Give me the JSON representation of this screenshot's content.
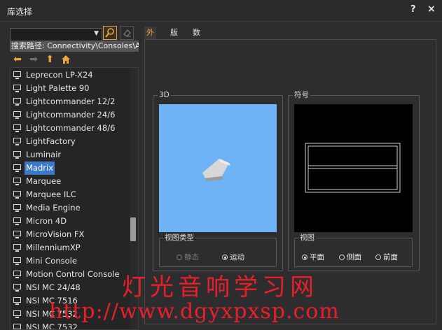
{
  "window": {
    "title": "库选择",
    "help": "?",
    "close": "×"
  },
  "search": {
    "value": "",
    "path": "搜索路径: Connectivity\\Consoles\\All"
  },
  "icons": {
    "find": "search-icon",
    "clear": "eraser-icon",
    "back": "arrow-left-icon",
    "forward": "arrow-right-icon",
    "up": "arrow-up-icon",
    "home": "home-icon",
    "item": "monitor-icon"
  },
  "colors": {
    "accent": "#f0a43a",
    "selection": "#3a78c8",
    "preview_bg": "#6fb3f7",
    "watermark": "#e8202a"
  },
  "list": {
    "selected_index": 7,
    "items": [
      "Leprecon LP-X24",
      "Light Palette 90",
      "Lightcommander 12/2",
      "Lightcommander 24/6",
      "Lightcommander 48/6",
      "LightFactory",
      "Luminair",
      "Madrix",
      "Marquee",
      "Marquee ILC",
      "Media Engine",
      "Micron 4D",
      "MicroVision FX",
      "MillenniumXP",
      "Mini Console",
      "Motion Control Console",
      "NSI MC 24/48",
      "NSI MC 7516",
      "NSI MC 7532",
      "NSI MC 7532"
    ]
  },
  "tabs": [
    "外观",
    "版本",
    "数据"
  ],
  "preview": {
    "label_3d": "3D",
    "label_symbol": "符号",
    "view_type_label": "视图类型",
    "view_type_options": [
      {
        "label": "静态",
        "checked": false,
        "disabled": true
      },
      {
        "label": "运动",
        "checked": true,
        "disabled": false
      }
    ],
    "view_label": "视图",
    "view_options": [
      {
        "label": "平面",
        "checked": true
      },
      {
        "label": "侧面",
        "checked": false
      },
      {
        "label": "前面",
        "checked": false
      }
    ]
  },
  "watermark": {
    "line1": "灯光音响学习网",
    "line2": "http://www.dgyxpxsp.com"
  }
}
